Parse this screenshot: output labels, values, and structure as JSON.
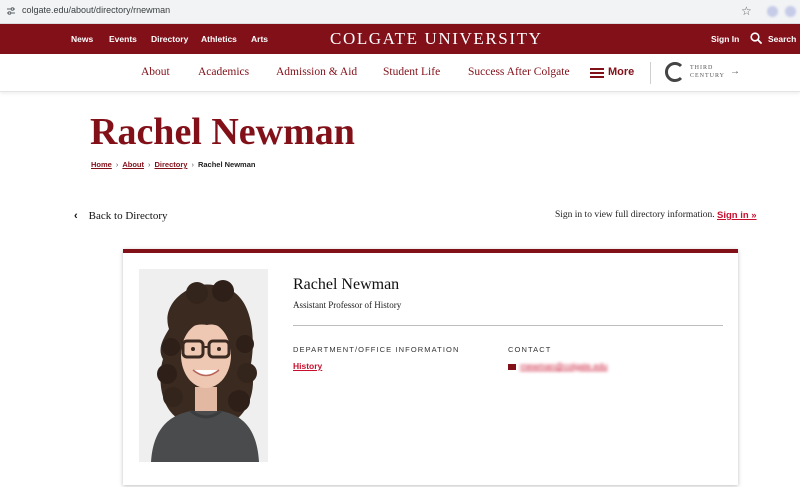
{
  "browser": {
    "url": "colgate.edu/about/directory/rnewman"
  },
  "topbar": {
    "links": [
      "News",
      "Events",
      "Directory",
      "Athletics",
      "Arts"
    ],
    "brand": "COLGATE UNIVERSITY",
    "signin": "Sign In",
    "search": "Search"
  },
  "mainnav": {
    "items": [
      "About",
      "Academics",
      "Admission & Aid",
      "Student Life",
      "Success After Colgate"
    ],
    "more": "More",
    "third_century": [
      "THIRD",
      "CENTURY"
    ]
  },
  "page": {
    "title": "Rachel Newman",
    "breadcrumb": [
      "Home",
      "About",
      "Directory",
      "Rachel Newman"
    ],
    "back_label": "Back to Directory",
    "signin_note": "Sign in to view full directory information.",
    "signin_link": "Sign in »"
  },
  "profile": {
    "name": "Rachel Newman",
    "position": "Assistant Professor of History",
    "dept_heading": "DEPARTMENT/OFFICE INFORMATION",
    "department": "History",
    "contact_heading": "CONTACT",
    "email": "rnewman@colgate.edu"
  },
  "colors": {
    "maroon": "#821019",
    "link_red": "#c8102e"
  }
}
